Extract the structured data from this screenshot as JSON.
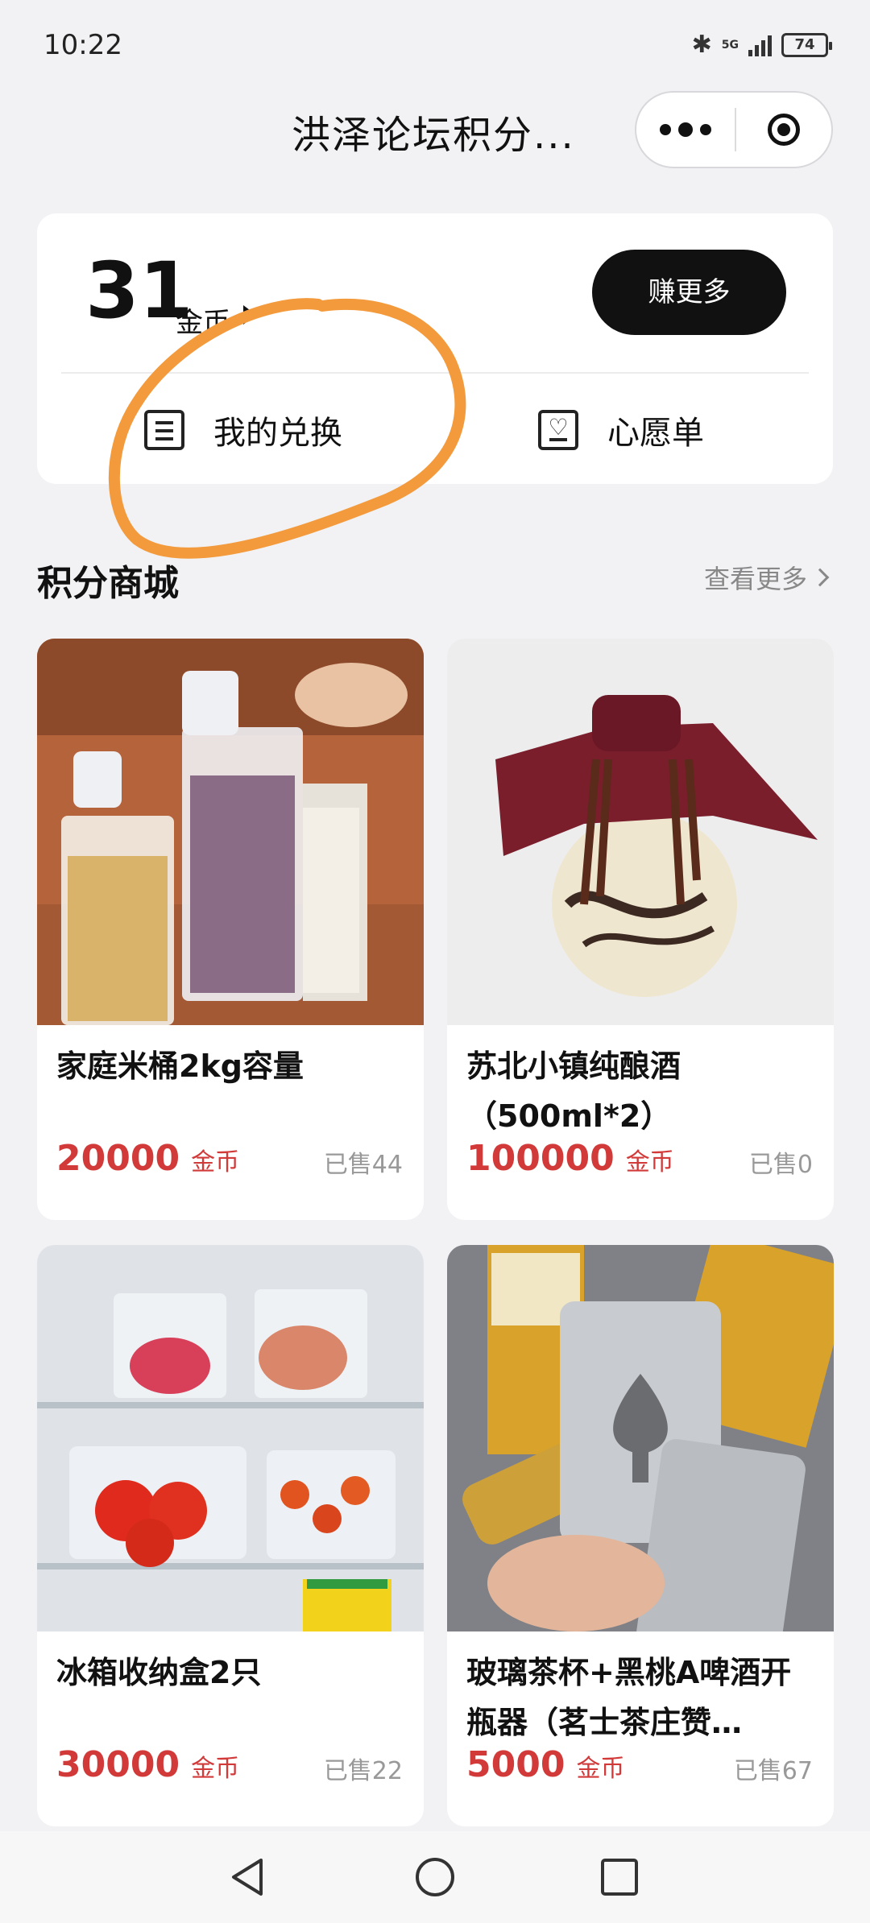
{
  "status_bar": {
    "time": "10:22",
    "signal_label": "5G",
    "battery": "74"
  },
  "header": {
    "title": "洪泽论坛积分..."
  },
  "points": {
    "value": "31",
    "unit": "金币",
    "earn_button": "赚更多",
    "my_exchange": "我的兑换",
    "wishlist": "心愿单"
  },
  "section": {
    "title": "积分商城",
    "more": "查看更多"
  },
  "products": [
    {
      "name": "家庭米桶2kg容量",
      "price": "20000",
      "unit": "金币",
      "sold": "已售44",
      "image": "rice-bucket-image"
    },
    {
      "name": "苏北小镇纯酿酒（500ml*2）",
      "price": "100000",
      "unit": "金币",
      "sold": "已售0",
      "image": "wine-jar-image"
    },
    {
      "name": "冰箱收纳盒2只",
      "price": "30000",
      "unit": "金币",
      "sold": "已售22",
      "image": "fridge-box-image"
    },
    {
      "name": "玻璃茶杯+黑桃A啤酒开瓶器（茗士茶庄赞…",
      "price": "5000",
      "unit": "金币",
      "sold": "已售67",
      "image": "bottle-opener-image"
    }
  ],
  "colors": {
    "price": "#d23a3a",
    "accent_button": "#111111",
    "annotation": "#f39a3c",
    "background": "#f2f2f4"
  },
  "icons": [
    "bluetooth-icon",
    "signal-icon",
    "battery-icon",
    "more-dots-icon",
    "close-target-icon",
    "caret-right-icon",
    "exchange-list-icon",
    "wishlist-heart-icon",
    "chevron-right-icon",
    "nav-back-icon",
    "nav-home-icon",
    "nav-recent-icon"
  ]
}
